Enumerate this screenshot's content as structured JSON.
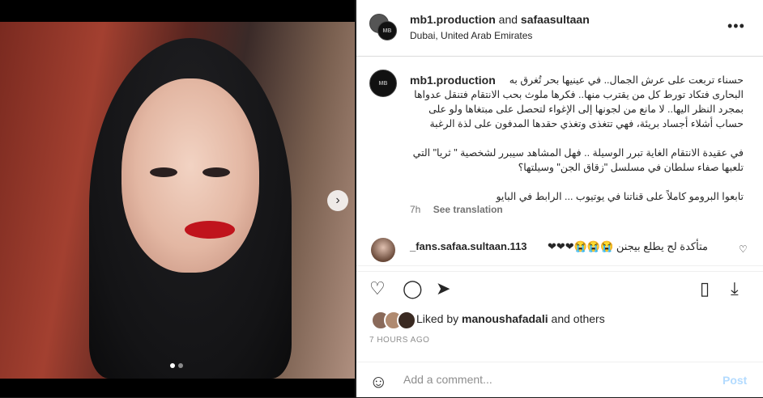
{
  "post": {
    "header": {
      "author": "mb1.production",
      "connector": "and",
      "coauthor": "safaasultaan",
      "location": "Dubai, United Arab Emirates",
      "more_icon": "more-horizontal-icon"
    },
    "caption": {
      "username": "mb1.production",
      "text": "حسناء تربعت على عرش الجمال.. في عينيها بحر تُغرق به البحارى فتكاد تورط كل من يقترب منها.. فكرها ملوث بحب الانتقام فتنقل عدواها بمجرد النظر اليها.. لا مانع من لجونها إلى الإغواء لتحصل على مبتغاها ولو على حساب أشلاء أجساد بريئة، فهي تتغذى وتغذي حقدها المدفون على لذة الرغبة\n\nفي عقيدة الانتقام الغاية تبرر الوسيلة .. فهل المشاهد سيبرر لشخصية \" ثريا\" التي تلعبها صفاء سلطان في مسلسل \"زقاق الجن\" وسيلتها؟\n\nتابعوا البرومو كاملاً على قناتنا في يوتيوب ... الرابط في البايو",
      "time": "7h",
      "translate_label": "See translation"
    },
    "comment": {
      "username": "_fans.safaa.sultaan.113",
      "text": "متأكدة لح يطلع بيجنن 😭😭😭❤❤❤"
    },
    "likes": {
      "prefix": "Liked by",
      "user": "manoushafadali",
      "suffix": "and others"
    },
    "timestamp": "7 HOURS AGO",
    "add_comment": {
      "placeholder": "Add a comment...",
      "post_label": "Post"
    }
  },
  "carousel": {
    "next_icon": "chevron-right-icon",
    "current": 1,
    "total": 2
  }
}
